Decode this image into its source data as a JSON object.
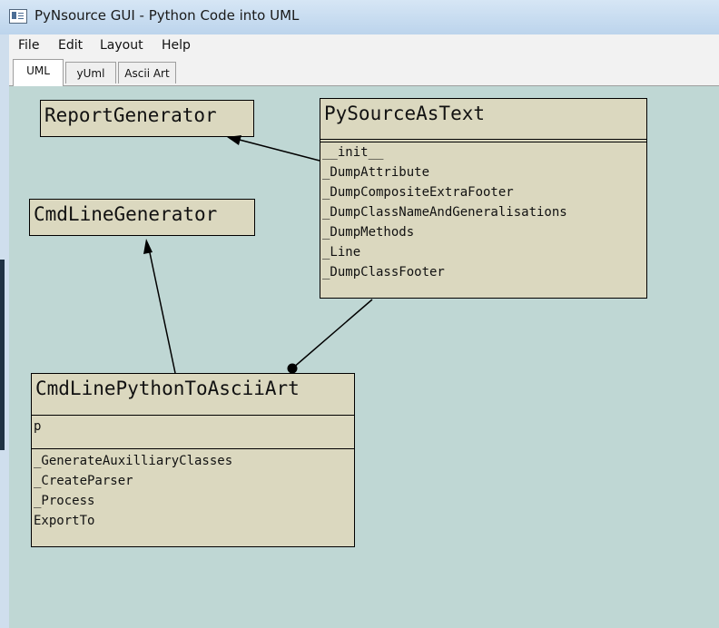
{
  "window": {
    "title": "PyNsource GUI - Python Code into UML"
  },
  "menu": {
    "items": [
      "File",
      "Edit",
      "Layout",
      "Help"
    ]
  },
  "tabs": {
    "items": [
      "UML",
      "yUml",
      "Ascii Art"
    ],
    "active": "UML"
  },
  "diagram": {
    "classes": {
      "report_generator": {
        "name": "ReportGenerator"
      },
      "cmd_line_generator": {
        "name": "CmdLineGenerator"
      },
      "py_source_as_text": {
        "name": "PySourceAsText",
        "attributes": [],
        "methods": [
          "__init__",
          "_DumpAttribute",
          "_DumpCompositeExtraFooter",
          "_DumpClassNameAndGeneralisations",
          "_DumpMethods",
          "_Line",
          "_DumpClassFooter"
        ]
      },
      "cmd_line_python_to_ascii_art": {
        "name": "CmdLinePythonToAsciiArt",
        "attributes": [
          "p"
        ],
        "methods": [
          "_GenerateAuxilliaryClasses",
          "_CreateParser",
          "_Process",
          "ExportTo"
        ]
      }
    },
    "relationships": [
      {
        "from": "PySourceAsText",
        "to": "ReportGenerator",
        "type": "generalization"
      },
      {
        "from": "CmdLinePythonToAsciiArt",
        "to": "CmdLineGenerator",
        "type": "generalization"
      },
      {
        "from": "PySourceAsText",
        "to": "CmdLinePythonToAsciiArt",
        "type": "composition"
      }
    ]
  },
  "colors": {
    "canvas_bg": "#bfd7d4",
    "class_fill": "#dbd8bf",
    "class_border": "#000000"
  }
}
